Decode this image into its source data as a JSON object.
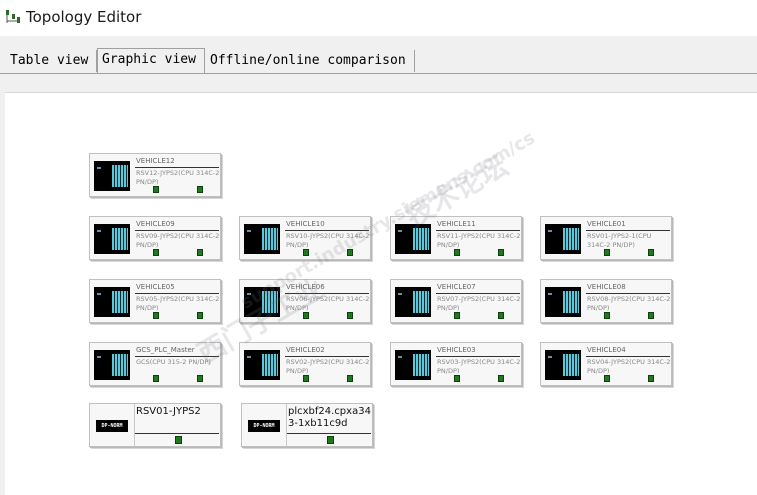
{
  "window": {
    "title": "Topology Editor"
  },
  "tabs": [
    {
      "label": "Table view"
    },
    {
      "label": "Graphic view"
    },
    {
      "label": "Offline/online comparison"
    }
  ],
  "stations": [
    {
      "name": "VEHICLE12",
      "desc": "RSV12-JYPS2(CPU 314C-2 PN/DP)"
    },
    {
      "name": "VEHICLE09",
      "desc": "RSV09-JYPS2(CPU 314C-2 PN/DP)"
    },
    {
      "name": "VEHICLE10",
      "desc": "RSV10-JYPS2(CPU 314C-2 PN/DP)"
    },
    {
      "name": "VEHICLE11",
      "desc": "RSV11-JYPS2(CPU 314C-2 PN/DP)"
    },
    {
      "name": "VEHICLE01",
      "desc": "RSV01-JYPS2-1(CPU 314C-2 PN/DP)"
    },
    {
      "name": "VEHICLE05",
      "desc": "RSV05-JYPS2(CPU 314C-2 PN/DP)"
    },
    {
      "name": "VEHICLE06",
      "desc": "RSV06-JYPS2(CPU 314C-2 PN/DP)"
    },
    {
      "name": "VEHICLE07",
      "desc": "RSV07-JYPS2(CPU 314C-2 PN/DP)"
    },
    {
      "name": "VEHICLE08",
      "desc": "RSV08-JYPS2(CPU 314C-2 PN/DP)"
    },
    {
      "name": "GCS_PLC_Master",
      "desc": "GCS(CPU 315-2 PN/DP)"
    },
    {
      "name": "VEHICLE02",
      "desc": "RSV02-JYPS2(CPU 314C-2 PN/DP)"
    },
    {
      "name": "VEHICLE03",
      "desc": "RSV03-JYPS2(CPU 314C-2 PN/DP)"
    },
    {
      "name": "VEHICLE04",
      "desc": "RSV04-JYPS2(CPU 314C-2 PN/DP)"
    }
  ],
  "devices": [
    {
      "name": "RSV01-JYPS2",
      "icon_label": "DP-NORM"
    },
    {
      "name": "plcxbf24.cpxa343-1xb11c9d",
      "icon_label": "DP-NORM"
    }
  ],
  "watermark": {
    "text1": "西门子工业",
    "text2": "support.industry.siemens.com/cs",
    "text3": "技术论坛"
  },
  "colors": {
    "port_green": "#1f7a1f",
    "rack_slots": "#5fc8d8",
    "canvas_bg": "#ffffff"
  }
}
